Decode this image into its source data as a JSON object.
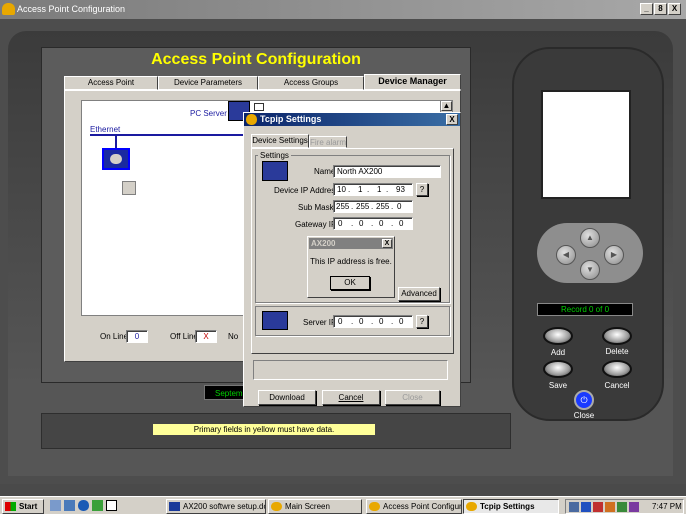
{
  "window": {
    "title": "Access Point Configuration",
    "controls": [
      "_",
      "8",
      "X"
    ]
  },
  "app": {
    "title": "Access Point Configuration",
    "tabs": [
      "Access Point",
      "Device Parameters",
      "Access Groups",
      "Device Manager"
    ],
    "network": {
      "pc_server": "PC Server",
      "ethernet": "Ethernet"
    },
    "footer": {
      "online_label": "On Line",
      "online_value": "0",
      "offline_label": "Off Line",
      "offline_value": "X",
      "extra_label": "No"
    },
    "date_fragment": "Septem",
    "status_message": "Primary fields in yellow must have data."
  },
  "dialog": {
    "title": "Tcpip Settings",
    "tabs": [
      "Device Settings",
      "Fire alarm"
    ],
    "group_label": "Settings",
    "name_label": "Name",
    "name_value": "North AX200",
    "device_ip_label": "Device IP Address",
    "device_ip": [
      "10",
      "1",
      "1",
      "93"
    ],
    "sub_mask_label": "Sub Mask",
    "sub_mask": [
      "255",
      "255",
      "255",
      "0"
    ],
    "gateway_label": "Gateway IP",
    "gateway": [
      "0",
      "0",
      "0",
      "0"
    ],
    "query_label": "?",
    "advanced_label": "Advanced",
    "server_ip_label": "Server IP",
    "server_ip": [
      "0",
      "0",
      "0",
      "0"
    ],
    "buttons": {
      "download": "Download",
      "cancel": "Cancel",
      "close": "Close"
    }
  },
  "msgbox": {
    "title": "AX200",
    "text": "This IP address is free.",
    "ok": "OK",
    "close": "X"
  },
  "device": {
    "record": "Record 0 of 0",
    "buttons": {
      "add": "Add",
      "delete": "Delete",
      "save": "Save",
      "cancel": "Cancel",
      "close": "Close"
    }
  },
  "taskbar": {
    "start": "Start",
    "items": [
      "AX200 softwre setup.do...",
      "Main Screen",
      "Access Point Configurat...",
      "Tcpip Settings"
    ],
    "clock": "7:47 PM"
  },
  "colors": {
    "title_yellow": "#ffff00",
    "record_green": "#00d000",
    "dialog_title": "#0a246a",
    "status_bg": "#ffff99"
  }
}
